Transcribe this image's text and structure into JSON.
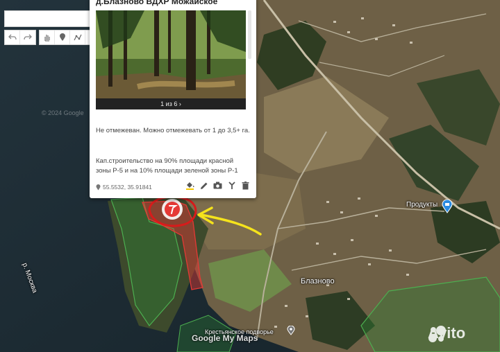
{
  "search": {
    "placeholder": "",
    "button_icon": "search-icon"
  },
  "toolbar": {
    "groups": [
      [
        "undo-icon",
        "redo-icon"
      ],
      [
        "hand-icon",
        "marker-icon",
        "polyline-icon",
        "route-icon",
        "ruler-icon"
      ]
    ]
  },
  "card": {
    "title": "д.Блазново ВДХР Можайское",
    "photo_counter": "1 из 6",
    "description_1": "Не отмежеван. Можно отмежевать от 1 до 3,5+ га.",
    "description_2": "Кап.строительство на 90% площади красной зоны Р-5 и на 10% площади зеленой зоны Р-1",
    "coordinates": "55.5532, 35.91841",
    "actions": [
      "paint-bucket-icon",
      "edit-pencil-icon",
      "camera-icon",
      "style-icon",
      "delete-icon"
    ]
  },
  "map": {
    "river_label": "р. Москва",
    "village_label": "Блазново",
    "shop_label": "Продукты",
    "farm_label": "Крестьянское подворье",
    "copyright": "© 2024 Google",
    "google_logo": "Google My Maps",
    "avito_logo": "Avito"
  },
  "colors": {
    "search_button": "#3b78e7",
    "plot_red": "#e53935",
    "zone_green": "#2e7d32",
    "arrow_yellow": "#f5e31c",
    "shop_pin": "#2b8be0"
  }
}
